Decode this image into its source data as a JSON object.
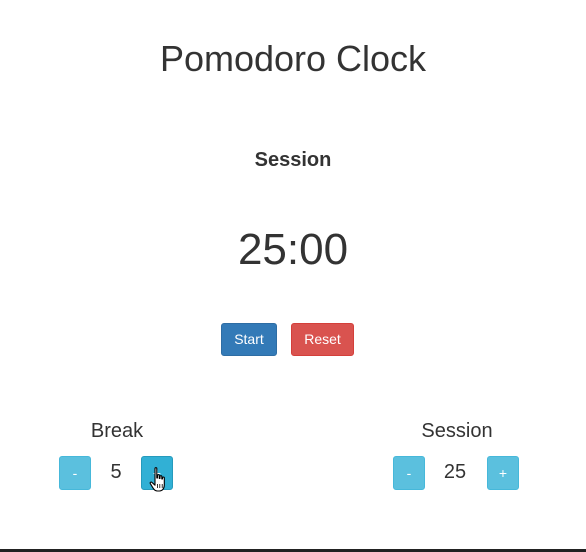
{
  "app": {
    "title": "Pomodoro Clock"
  },
  "timer": {
    "mode_label": "Session",
    "display": "25:00"
  },
  "actions": {
    "start_label": "Start",
    "reset_label": "Reset"
  },
  "break_control": {
    "label": "Break",
    "decrement_label": "-",
    "value": "5",
    "increment_label": "+"
  },
  "session_control": {
    "label": "Session",
    "decrement_label": "-",
    "value": "25",
    "increment_label": "+"
  },
  "colors": {
    "primary": "#337ab7",
    "danger": "#d9534f",
    "info": "#5bc0de",
    "text": "#333333"
  },
  "icons": {
    "cursor": "hand-pointer-icon"
  }
}
